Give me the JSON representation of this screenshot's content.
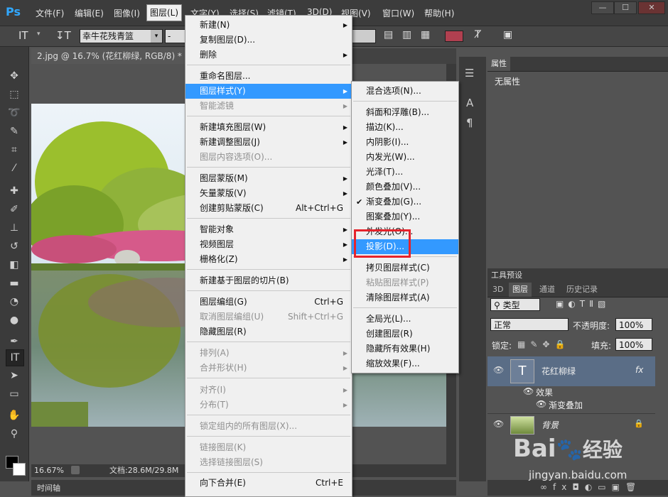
{
  "app": {
    "logo": "Ps"
  },
  "menubar": {
    "items": [
      "文件(F)",
      "编辑(E)",
      "图像(I)",
      "图层(L)",
      "文字(Y)",
      "选择(S)",
      "滤镜(T)",
      "3D(D)",
      "视图(V)",
      "窗口(W)",
      "帮助(H)"
    ],
    "window_controls": [
      "—",
      "☐",
      "✕"
    ]
  },
  "options_bar": {
    "font_family": "幸牛花残青篮",
    "font_style": "-"
  },
  "document": {
    "tab_title": "2.jpg @ 16.7% (花红柳绿, RGB/8) *",
    "tab_close": "×",
    "zoom": "16.67%",
    "doc_info": "文档:28.6M/29.8M",
    "timeline_label": "时间轴"
  },
  "layer_menu": {
    "items": [
      {
        "label": "新建(N)",
        "arrow": true
      },
      {
        "label": "复制图层(D)..."
      },
      {
        "label": "删除",
        "arrow": true
      },
      {
        "label": "重命名图层..."
      },
      {
        "label": "图层样式(Y)",
        "arrow": true,
        "highlight": true
      },
      {
        "label": "智能滤镜",
        "disabled": true,
        "arrow": true
      },
      {
        "label": "新建填充图层(W)",
        "arrow": true
      },
      {
        "label": "新建调整图层(J)",
        "arrow": true
      },
      {
        "label": "图层内容选项(O)...",
        "disabled": true
      },
      {
        "label": "图层蒙版(M)",
        "arrow": true
      },
      {
        "label": "矢量蒙版(V)",
        "arrow": true
      },
      {
        "label": "创建剪贴蒙版(C)",
        "shortcut": "Alt+Ctrl+G"
      },
      {
        "label": "智能对象",
        "arrow": true
      },
      {
        "label": "视频图层",
        "arrow": true
      },
      {
        "label": "栅格化(Z)",
        "arrow": true
      },
      {
        "label": "新建基于图层的切片(B)"
      },
      {
        "label": "图层编组(G)",
        "shortcut": "Ctrl+G"
      },
      {
        "label": "取消图层编组(U)",
        "shortcut": "Shift+Ctrl+G",
        "disabled": true
      },
      {
        "label": "隐藏图层(R)"
      },
      {
        "label": "排列(A)",
        "arrow": true,
        "disabled": true
      },
      {
        "label": "合并形状(H)",
        "arrow": true,
        "disabled": true
      },
      {
        "label": "对齐(I)",
        "arrow": true,
        "disabled": true
      },
      {
        "label": "分布(T)",
        "arrow": true,
        "disabled": true
      },
      {
        "label": "锁定组内的所有图层(X)...",
        "disabled": true
      },
      {
        "label": "链接图层(K)",
        "disabled": true
      },
      {
        "label": "选择链接图层(S)",
        "disabled": true
      },
      {
        "label": "向下合并(E)",
        "shortcut": "Ctrl+E"
      }
    ]
  },
  "style_submenu": {
    "items": [
      {
        "label": "混合选项(N)..."
      },
      {
        "label": "斜面和浮雕(B)..."
      },
      {
        "label": "描边(K)..."
      },
      {
        "label": "内阴影(I)..."
      },
      {
        "label": "内发光(W)..."
      },
      {
        "label": "光泽(T)..."
      },
      {
        "label": "颜色叠加(V)..."
      },
      {
        "label": "渐变叠加(G)...",
        "checked": true
      },
      {
        "label": "图案叠加(Y)..."
      },
      {
        "label": "外发光(O)..."
      },
      {
        "label": "投影(D)...",
        "highlight": true
      },
      {
        "label": "拷贝图层样式(C)"
      },
      {
        "label": "粘贴图层样式(P)",
        "disabled": true
      },
      {
        "label": "清除图层样式(A)"
      },
      {
        "label": "全局光(L)..."
      },
      {
        "label": "创建图层(R)"
      },
      {
        "label": "隐藏所有效果(H)"
      },
      {
        "label": "缩放效果(F)..."
      }
    ]
  },
  "properties_panel": {
    "title": "属性",
    "content": "无属性"
  },
  "tool_presets": {
    "title": "工具预设"
  },
  "layers_panel": {
    "tabs": [
      "3D",
      "图层",
      "通道",
      "历史记录"
    ],
    "filter_type": "类型",
    "blend_mode": "正常",
    "opacity_label": "不透明度:",
    "opacity_value": "100%",
    "lock_label": "锁定:",
    "fill_label": "填充:",
    "fill_value": "100%",
    "layers": [
      {
        "name": "花红柳绿",
        "thumb": "T",
        "fx": "fx"
      },
      {
        "name": "效果"
      },
      {
        "name": "渐变叠加"
      },
      {
        "name": "背景"
      }
    ]
  },
  "watermark": {
    "brand": "Bai",
    "brand_cn": "经验",
    "url": "jingyan.baidu.com"
  }
}
